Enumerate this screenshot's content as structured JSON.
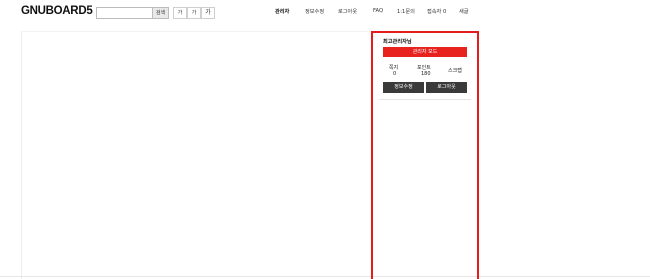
{
  "header": {
    "logo": "GNUBOARD5",
    "search": {
      "placeholder": "",
      "button_label": "검색"
    },
    "font_size_buttons": [
      "가",
      "가",
      "가"
    ]
  },
  "gnb": {
    "items": [
      "관리자",
      "정보수정",
      "로그아웃",
      "FAQ",
      "1:1문의",
      "접속자 0",
      "새글"
    ]
  },
  "outlogin": {
    "title": "최고관리자님",
    "admin_mode_label": "관리자 모드",
    "stats": [
      {
        "label": "쪽지",
        "value": "0"
      },
      {
        "label": "포인트",
        "value": "180"
      }
    ],
    "scrap_label": "스크랩",
    "modify_label": "정보수정",
    "logout_label": "로그아웃"
  },
  "colors": {
    "accent": "#e8221d",
    "highlight_border": "#e31c1c",
    "button_dark": "#3a3a3a"
  }
}
